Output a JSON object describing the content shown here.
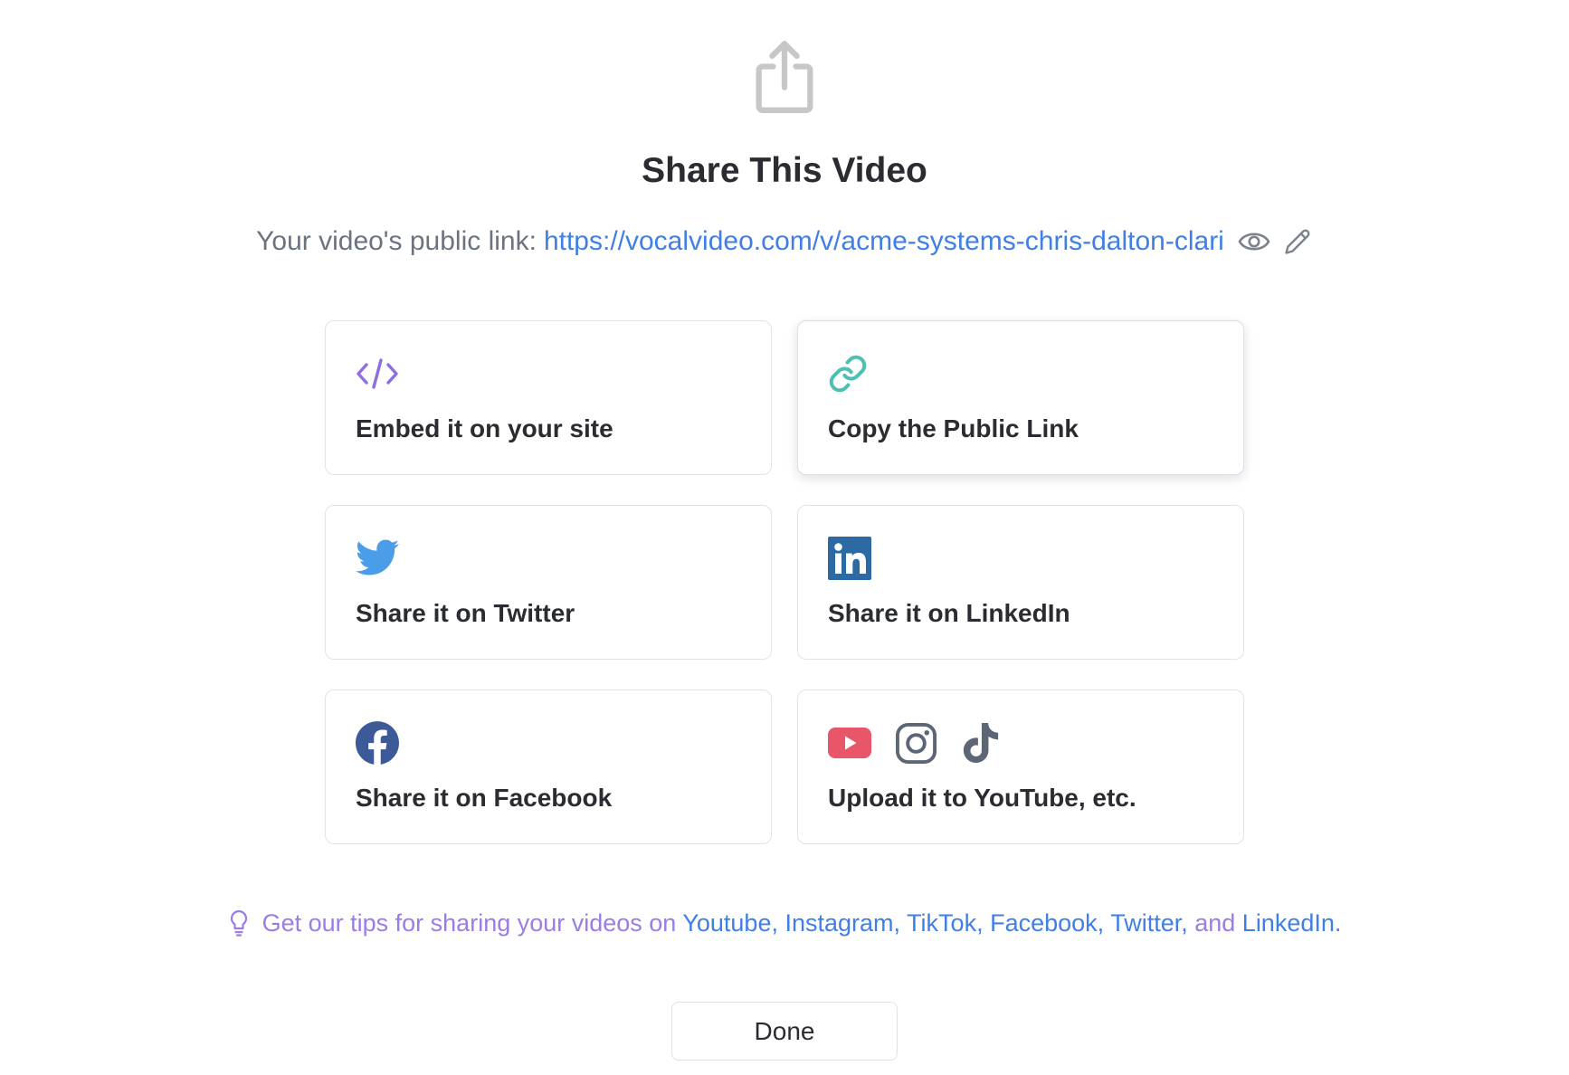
{
  "dialog": {
    "header_icon": "share-upload-icon",
    "title": "Share This Video",
    "link_label": "Your video's public link:",
    "public_link": "https://vocalvideo.com/v/acme-systems-chris-dalton-clari",
    "link_actions": [
      {
        "icon": "eye-icon"
      },
      {
        "icon": "pencil-icon"
      }
    ]
  },
  "options": [
    {
      "label": "Embed it on your site",
      "icon": "code-icon"
    },
    {
      "label": "Copy the Public Link",
      "icon": "link-icon"
    },
    {
      "label": "Share it on Twitter",
      "icon": "twitter-icon"
    },
    {
      "label": "Share it on LinkedIn",
      "icon": "linkedin-icon"
    },
    {
      "label": "Share it on Facebook",
      "icon": "facebook-icon"
    },
    {
      "label": "Upload it to YouTube, etc.",
      "icons": [
        "youtube-icon",
        "instagram-icon",
        "tiktok-icon"
      ]
    }
  ],
  "tips": {
    "icon": "lightbulb-icon",
    "segments": [
      "Get our tips for sharing your videos on ",
      "Youtube",
      ", ",
      "Instagram",
      ", ",
      "TikTok",
      ", ",
      "Facebook",
      ", ",
      "Twitter",
      ", ",
      "and ",
      "LinkedIn",
      "."
    ]
  },
  "done_label": "Done",
  "colors": {
    "title": "#2a2c31",
    "muted_text": "#6b7280",
    "link_blue": "#3f7fe6",
    "tips_purple": "#9a7de6",
    "code_purple": "#8e6ee4",
    "link_teal": "#4fbfb3",
    "twitter_blue": "#4a9de9",
    "linkedin_blue": "#2d6aa3",
    "facebook_blue": "#3d5a98",
    "youtube_red": "#e8566a",
    "icon_gray": "#5c6675"
  }
}
